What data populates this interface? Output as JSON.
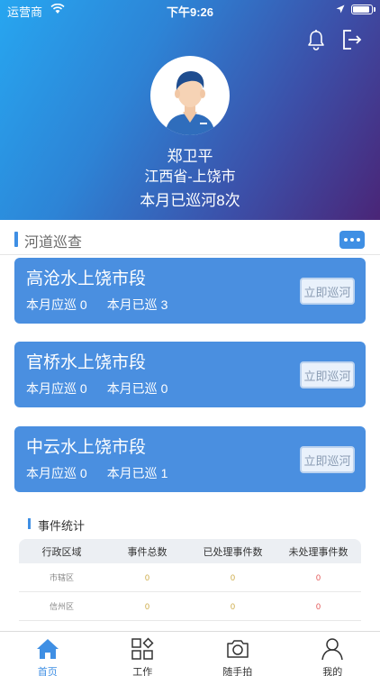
{
  "status_bar": {
    "carrier": "运营商",
    "time": "下午9:26",
    "battery_level": 0.9
  },
  "profile": {
    "name": "郑卫平",
    "location": "江西省-上饶市",
    "patrol_summary": "本月已巡河8次"
  },
  "section": {
    "title": "河道巡查"
  },
  "rivers": [
    {
      "name": "高沧水上饶市段",
      "should_label": "本月应巡 0",
      "done_label": "本月已巡 3",
      "button": "立即巡河"
    },
    {
      "name": "官桥水上饶市段",
      "should_label": "本月应巡 0",
      "done_label": "本月已巡 0",
      "button": "立即巡河"
    },
    {
      "name": "中云水上饶市段",
      "should_label": "本月应巡 0",
      "done_label": "本月已巡 1",
      "button": "立即巡河"
    }
  ],
  "stats": {
    "title": "事件统计",
    "headers": [
      "行政区域",
      "事件总数",
      "已处理事件数",
      "未处理事件数"
    ],
    "rows": [
      [
        "市辖区",
        "0",
        "0",
        "0"
      ],
      [
        "信州区",
        "0",
        "0",
        "0"
      ]
    ]
  },
  "tabs": [
    {
      "label": "首页",
      "icon": "home-icon"
    },
    {
      "label": "工作",
      "icon": "grid-icon"
    },
    {
      "label": "随手拍",
      "icon": "camera-icon"
    },
    {
      "label": "我的",
      "icon": "user-icon"
    }
  ],
  "colors": {
    "accent": "#3f8fe4",
    "card": "#4a8fe0",
    "unprocessed": "#e04b4b",
    "count": "#c9a53b"
  }
}
